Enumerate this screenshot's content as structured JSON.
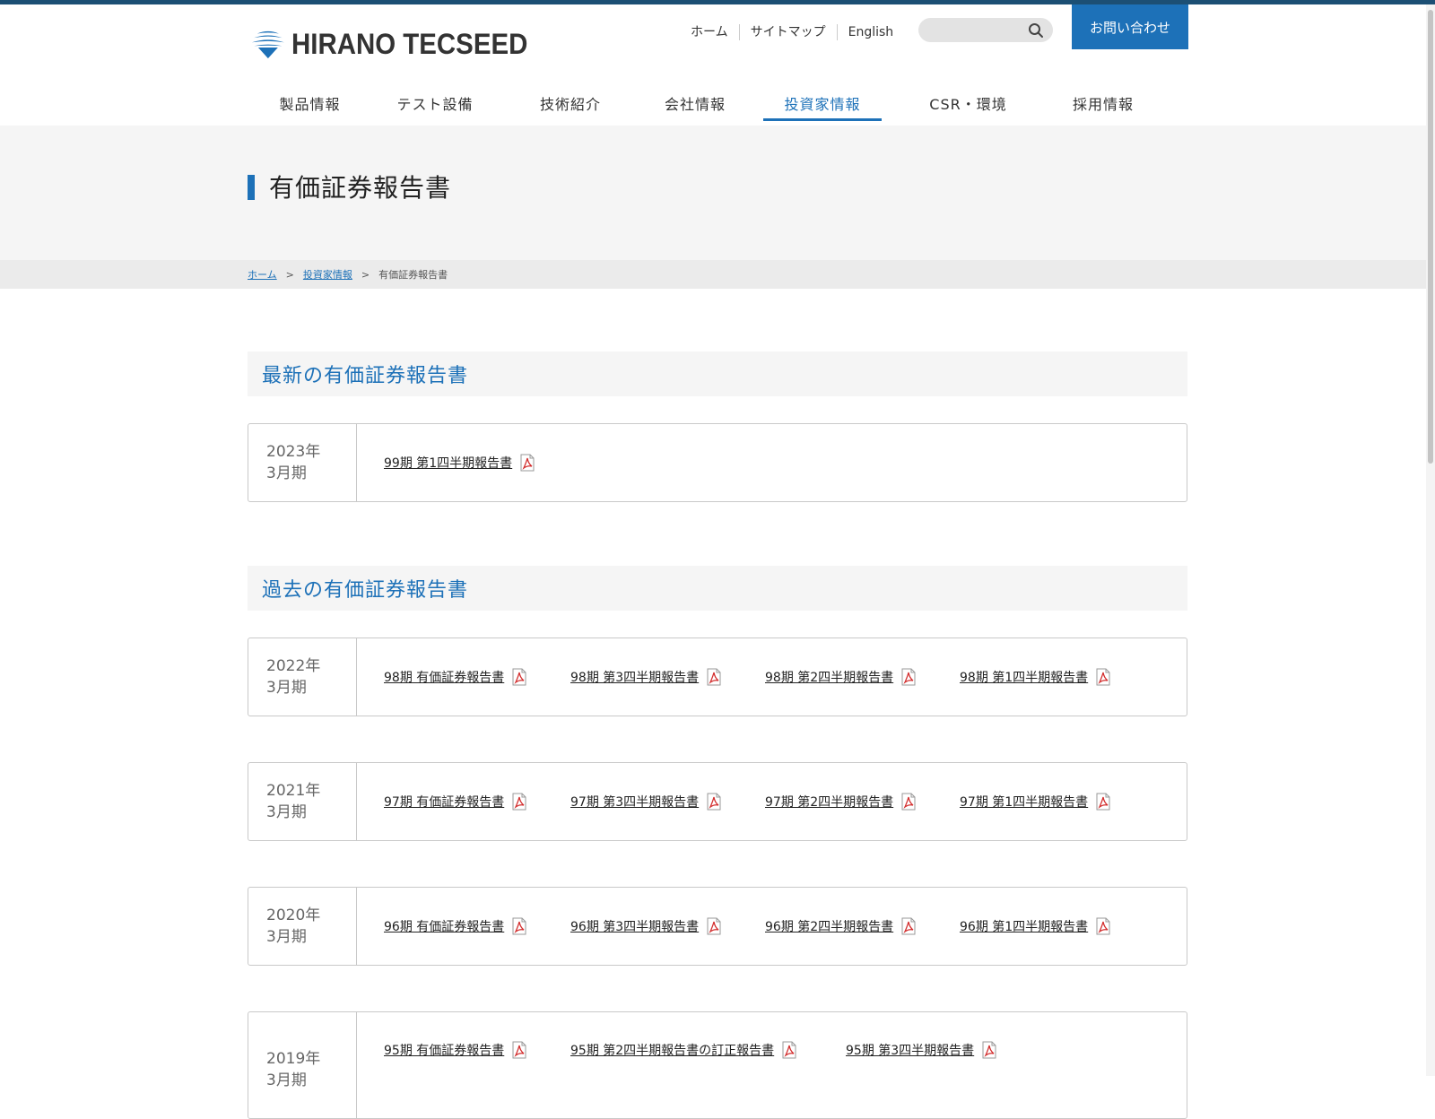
{
  "brand": {
    "name": "HIRANO TECSEED",
    "accent": "#1d71b8",
    "topline": "#1c4f74"
  },
  "util_links": [
    "ホーム",
    "サイトマップ",
    "English"
  ],
  "search": {
    "placeholder": "",
    "icon": "search-icon"
  },
  "contact_label": "お問い合わせ",
  "nav": [
    "製品情報",
    "テスト設備",
    "技術紹介",
    "会社情報",
    "投資家情報",
    "CSR・環境",
    "採用情報"
  ],
  "nav_active": "投資家情報",
  "page_title": "有価証券報告書",
  "breadcrumb": {
    "home": "ホーム",
    "parent": "投資家情報",
    "current": "有価証券報告書",
    "separator": ">"
  },
  "latest": {
    "heading": "最新の有価証券報告書",
    "rows": [
      {
        "year": "2023年",
        "term": "3月期",
        "docs": [
          "99期 第1四半期報告書"
        ]
      }
    ]
  },
  "past": {
    "heading": "過去の有価証券報告書",
    "rows": [
      {
        "year": "2022年",
        "term": "3月期",
        "docs": [
          "98期 有価証券報告書",
          "98期 第3四半期報告書",
          "98期 第2四半期報告書",
          "98期 第1四半期報告書"
        ]
      },
      {
        "year": "2021年",
        "term": "3月期",
        "docs": [
          "97期 有価証券報告書",
          "97期 第3四半期報告書",
          "97期 第2四半期報告書",
          "97期 第1四半期報告書"
        ]
      },
      {
        "year": "2020年",
        "term": "3月期",
        "docs": [
          "96期 有価証券報告書",
          "96期 第3四半期報告書",
          "96期 第2四半期報告書",
          "96期 第1四半期報告書"
        ]
      },
      {
        "year": "2019年",
        "term": "3月期",
        "docs": [
          "95期 有価証券報告書",
          "95期 第2四半期報告書の訂正報告書",
          "95期 第3四半期報告書"
        ]
      }
    ]
  }
}
